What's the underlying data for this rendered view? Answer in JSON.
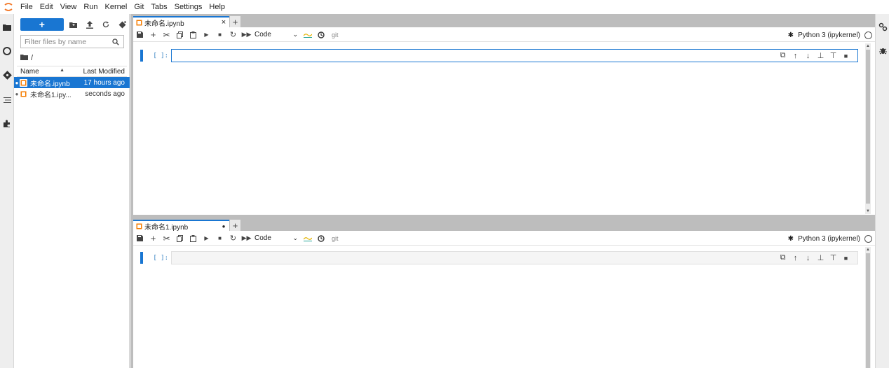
{
  "menubar": {
    "items": [
      "File",
      "Edit",
      "View",
      "Run",
      "Kernel",
      "Git",
      "Tabs",
      "Settings",
      "Help"
    ],
    "logo_icon": "jupyter-logo-icon"
  },
  "leftbar": {
    "icons": [
      "folder-icon",
      "running-icon",
      "git-icon",
      "table-of-contents-icon",
      "extensions-icon"
    ]
  },
  "filebrowser": {
    "new_label": "+",
    "filter_placeholder": "Filter files by name",
    "breadcrumb": "/",
    "columns": {
      "name": "Name",
      "modified": "Last Modified"
    },
    "files": [
      {
        "name": "未命名.ipynb",
        "modified": "17 hours ago",
        "selected": true
      },
      {
        "name": "未命名1.ipy...",
        "modified": "seconds ago",
        "selected": false
      }
    ]
  },
  "panels": [
    {
      "tab_label": "未命名.ipynb",
      "tab_state": "×",
      "add_tab": "+",
      "cell_type": "Code",
      "git_label": "git",
      "kernel": "Python 3 (ipykernel)",
      "cell_prompt": "[ ]:",
      "cell_active": true
    },
    {
      "tab_label": "未命名1.ipynb",
      "tab_state": "●",
      "add_tab": "+",
      "cell_type": "Code",
      "git_label": "git",
      "kernel": "Python 3 (ipykernel)",
      "cell_prompt": "[ ]:",
      "cell_active": false
    }
  ],
  "colors": {
    "accent": "#1976d2",
    "notebook_icon": "#f57c00"
  },
  "rightbar": {
    "icons": [
      "property-inspector-icon",
      "debugger-icon"
    ]
  }
}
